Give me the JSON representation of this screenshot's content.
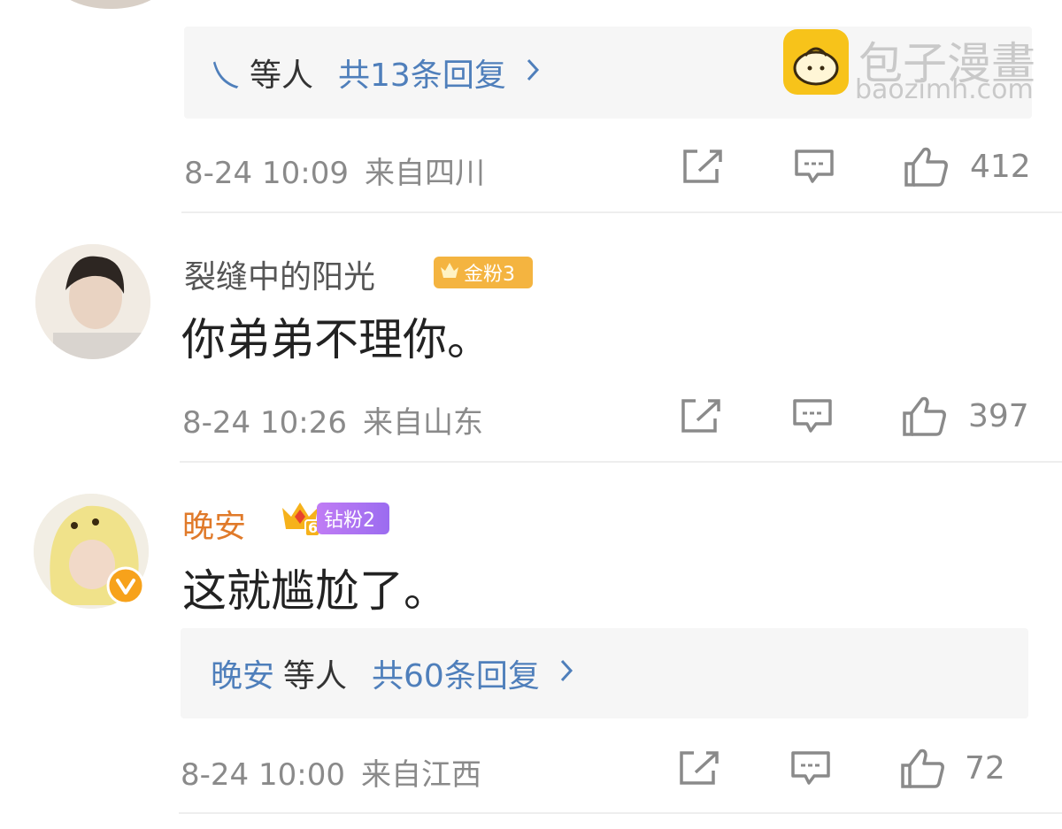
{
  "colors": {
    "link_blue": "#4f7fbb",
    "meta_gray": "#8a8a8a",
    "orange_name": "#e07a2a",
    "gold_badge": "#f4b400",
    "diamond_badge": "#b06cf0"
  },
  "watermark": {
    "title": "包子漫畫",
    "domain": "baozimh.com"
  },
  "threads": [
    {
      "reply_summary": {
        "who": "乀",
        "others": "等人",
        "total": "共13条回复"
      },
      "meta": {
        "date": "8-24 10:09",
        "location": "来自四川"
      },
      "likes": "412"
    },
    {
      "username": "裂缝中的阳光",
      "badge": "金粉3",
      "text": "你弟弟不理你。",
      "meta": {
        "date": "8-24 10:26",
        "location": "来自山东"
      },
      "likes": "397"
    },
    {
      "username": "晚安",
      "badge": "钻粉2",
      "badge_level": "6",
      "text": "这就尴尬了。",
      "reply_summary": {
        "who": "晚安",
        "others": "等人",
        "total": "共60条回复"
      },
      "meta": {
        "date": "8-24 10:00",
        "location": "来自江西"
      },
      "likes": "72"
    }
  ],
  "icons": {
    "share": "share-icon",
    "comment": "comment-icon",
    "like": "thumbs-up-icon",
    "chevron": "chevron-right-icon",
    "verified": "verified-v-icon"
  }
}
